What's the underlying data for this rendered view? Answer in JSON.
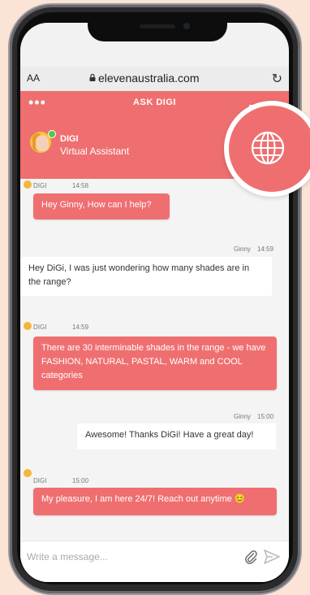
{
  "browser": {
    "aa_label": "AA",
    "url": "elevenaustralia.com",
    "reload_icon": "reload-icon"
  },
  "header": {
    "title": "ASK DIGI",
    "bot_name": "DIGI",
    "bot_role": "Virtual Assistant",
    "brand_color": "#ef6f70"
  },
  "messages": [
    {
      "sender": "DIGI",
      "time": "14:58",
      "text": "Hey Ginny, How can I help?"
    },
    {
      "sender": "Ginny",
      "time": "14:59",
      "text": "Hey DiGi, I was just wondering how many shades are in the range?"
    },
    {
      "sender": "DIGI",
      "time": "14:59",
      "text": "There are 30 interminable shades in the range - we have FASHION, NATURAL, PASTAL, WARM and COOL categories"
    },
    {
      "sender": "Ginny",
      "time": "15:00",
      "text": "Awesome! Thanks DiGi! Have a great day!"
    },
    {
      "sender": "DIGI",
      "time": "15:00",
      "text": "My pleasure, I am here 24/7! Reach out anytime 😊"
    }
  ],
  "composer": {
    "placeholder": "Write a message..."
  }
}
